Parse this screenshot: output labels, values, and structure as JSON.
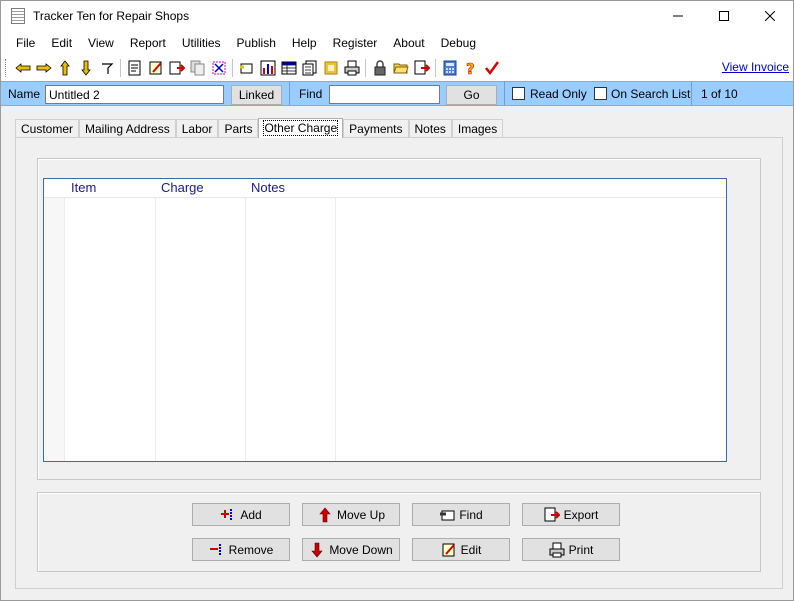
{
  "window": {
    "title": "Tracker Ten for Repair Shops",
    "controls": {
      "minimize": "minimize-icon",
      "maximize": "maximize-icon",
      "close": "close-icon"
    }
  },
  "menu": [
    "File",
    "Edit",
    "View",
    "Report",
    "Utilities",
    "Publish",
    "Help",
    "Register",
    "About",
    "Debug"
  ],
  "toolbar": {
    "icons": [
      "first-record-icon",
      "previous-record-icon",
      "next-record-icon",
      "last-record-icon",
      "go-to-record-icon",
      "new-record-icon",
      "edit-record-icon",
      "delete-record-icon",
      "copy-record-icon",
      "clear-icon",
      "find-icon",
      "chart-icon",
      "table-icon",
      "list-icon",
      "photo-icon",
      "print-icon",
      "lock-icon",
      "open-folder-icon",
      "export-icon",
      "calculator-icon",
      "help-icon",
      "spellcheck-icon"
    ],
    "view_invoice": "View Invoice"
  },
  "searchbar": {
    "name_label": "Name",
    "name_value": "Untitled 2",
    "linked_label": "Linked",
    "find_label": "Find",
    "find_value": "",
    "go_label": "Go",
    "read_only_label": "Read Only",
    "on_search_list_label": "On Search List",
    "record_position": "1 of 10"
  },
  "tabs": [
    "Customer",
    "Mailing Address",
    "Labor",
    "Parts",
    "Other Charge",
    "Payments",
    "Notes",
    "Images"
  ],
  "active_tab": "Other Charge",
  "grid": {
    "columns": [
      "Item",
      "Charge",
      "Notes"
    ],
    "rows": []
  },
  "actions": {
    "add": "Add",
    "remove": "Remove",
    "move_up": "Move Up",
    "move_down": "Move Down",
    "find": "Find",
    "edit": "Edit",
    "export": "Export",
    "print": "Print"
  },
  "colors": {
    "searchbar_bg": "#99ccff",
    "link": "#0000cc",
    "grid_header_text": "#1a1a8c",
    "grid_border": "#3d6aa8"
  }
}
